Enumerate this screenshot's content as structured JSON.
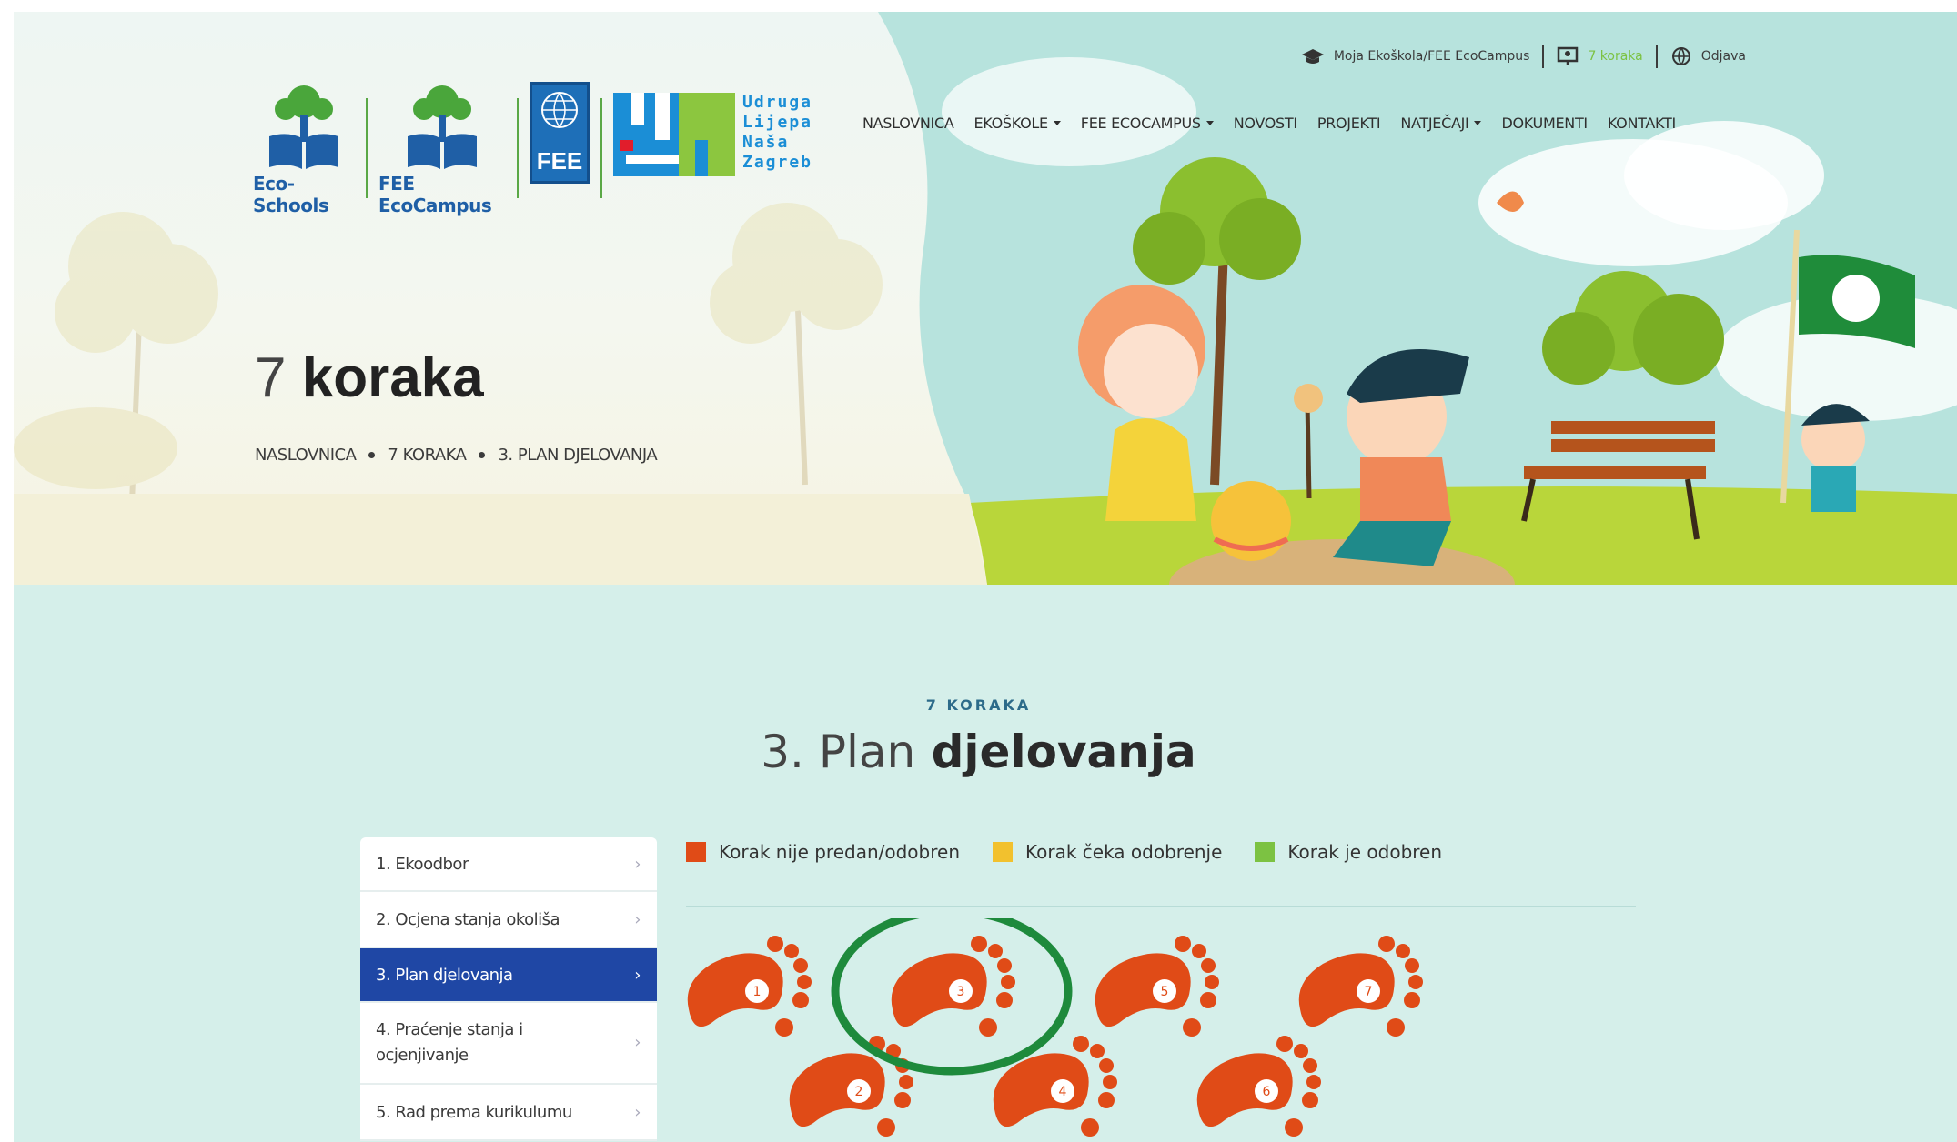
{
  "topbar": {
    "account_label": "Moja Ekoškola/FEE EcoCampus",
    "steps_label": "7 koraka",
    "logout_label": "Odjava"
  },
  "logos": {
    "eco_schools": "Eco-Schools",
    "fee_ecocampus": "FEE EcoCampus",
    "fee": "FEE",
    "uln_lines": [
      "Udruga",
      "Lijepa",
      "Naša",
      "Zagreb"
    ]
  },
  "nav": {
    "home": "NASLOVNICA",
    "ekoskole": "EKOŠKOLE",
    "fee_ecocampus": "FEE ECOCAMPUS",
    "novosti": "NOVOSTI",
    "projekti": "PROJEKTI",
    "natjecaji": "NATJEČAJI",
    "dokumenti": "DOKUMENTI",
    "kontakti": "KONTAKTI"
  },
  "hero": {
    "title_light": "7",
    "title_bold": "koraka",
    "breadcrumb": [
      "NASLOVNICA",
      "7 KORAKA",
      "3. PLAN DJELOVANJA"
    ]
  },
  "section": {
    "kicker": "7 KORAKA",
    "title_light": "3. Plan",
    "title_bold": "djelovanja"
  },
  "steps_menu": [
    {
      "label": "1. Ekoodbor",
      "active": false
    },
    {
      "label": "2. Ocjena stanja okoliša",
      "active": false
    },
    {
      "label": "3. Plan djelovanja",
      "active": true
    },
    {
      "label": "4. Praćenje stanja i ocjenjivanje",
      "active": false
    },
    {
      "label": "5. Rad prema kurikulumu",
      "active": false
    }
  ],
  "legend": [
    {
      "label": "Korak nije predan/odobren",
      "color": "#e04b17"
    },
    {
      "label": "Korak čeka odobrenje",
      "color": "#f2c12e"
    },
    {
      "label": "Korak je odobren",
      "color": "#7cc242"
    }
  ],
  "footsteps": [
    {
      "number": "1",
      "status": "not-submitted"
    },
    {
      "number": "2",
      "status": "not-submitted"
    },
    {
      "number": "3",
      "status": "not-submitted",
      "highlighted": true
    },
    {
      "number": "4",
      "status": "not-submitted"
    },
    {
      "number": "5",
      "status": "not-submitted"
    },
    {
      "number": "6",
      "status": "not-submitted"
    },
    {
      "number": "7",
      "status": "not-submitted"
    }
  ],
  "colors": {
    "accent_green": "#7cc242",
    "active_blue": "#1f47a5",
    "foot_red": "#e04b17",
    "highlight_ring": "#1e8a3c",
    "content_bg": "#d5efea"
  }
}
